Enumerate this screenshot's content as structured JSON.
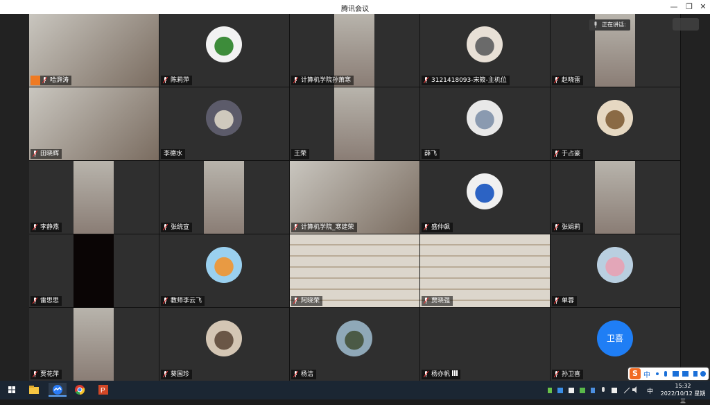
{
  "window": {
    "title": "腾讯会议",
    "minimize_icon": "minimize-icon",
    "restore_icon": "restore-icon",
    "close_icon": "close-icon"
  },
  "speaking_indicator": {
    "label": "正在讲话:"
  },
  "participants": [
    {
      "name": "哈湃涛",
      "type": "video",
      "host": true
    },
    {
      "name": "陈莉萍",
      "type": "avatar",
      "avatar": "clover"
    },
    {
      "name": "计算机学院孙萧寒",
      "type": "portrait"
    },
    {
      "name": "3121418093-宋筱-主机位",
      "type": "avatar",
      "avatar": "cat"
    },
    {
      "name": "赵晓雷",
      "type": "portrait"
    },
    {
      "name": "田晓辉",
      "type": "video"
    },
    {
      "name": "李德水",
      "type": "avatar",
      "avatar": "photo",
      "no_mic": true
    },
    {
      "name": "王荣",
      "type": "portrait",
      "no_mic": true
    },
    {
      "name": "薛飞",
      "type": "avatar",
      "avatar": "sketch",
      "no_mic": true
    },
    {
      "name": "于占豪",
      "type": "avatar",
      "avatar": "hamster"
    },
    {
      "name": "李静燕",
      "type": "portrait"
    },
    {
      "name": "张统宣",
      "type": "portrait"
    },
    {
      "name": "计算机学院_寒建荣",
      "type": "video"
    },
    {
      "name": "盛仲飙",
      "type": "avatar",
      "avatar": "roses"
    },
    {
      "name": "张娟莉",
      "type": "portrait"
    },
    {
      "name": "雷思思",
      "type": "portrait-dark"
    },
    {
      "name": "教师李云飞",
      "type": "avatar",
      "avatar": "cartoon"
    },
    {
      "name": "阿晓荣",
      "type": "video-room"
    },
    {
      "name": "贾晓强",
      "type": "video-room"
    },
    {
      "name": "单蓉",
      "type": "avatar",
      "avatar": "flower"
    },
    {
      "name": "贾花萍",
      "type": "portrait"
    },
    {
      "name": "葵国珍",
      "type": "avatar",
      "avatar": "sunset"
    },
    {
      "name": "杨洁",
      "type": "avatar",
      "avatar": "lake"
    },
    {
      "name": "杨亦帆",
      "type": "empty",
      "signal": true
    },
    {
      "name": "孙卫喜",
      "type": "avatar-text",
      "avatar_text": "卫喜"
    }
  ],
  "taskbar": {
    "start_icon": "windows-start-icon",
    "apps": [
      "file-explorer-icon",
      "tencent-meeting-icon",
      "chrome-icon",
      "powerpoint-icon"
    ],
    "tray_lang": "中",
    "time": "15:32",
    "date": "2022/10/12 星期三"
  },
  "ime": {
    "logo": "S",
    "mode": "中"
  },
  "colors": {
    "accent": "#1f7ef5",
    "host_badge": "#ef7a22",
    "taskbar": "#1b2633"
  }
}
